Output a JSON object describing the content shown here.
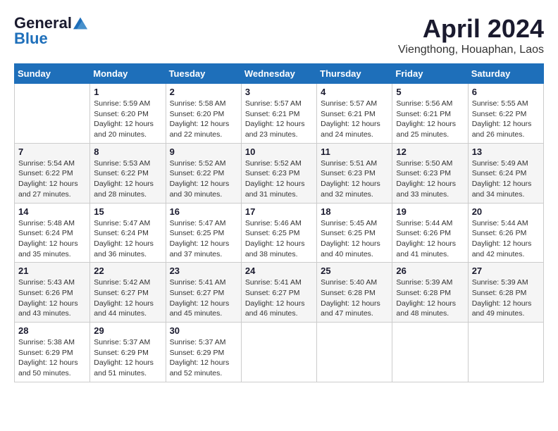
{
  "header": {
    "logo_general": "General",
    "logo_blue": "Blue",
    "month_title": "April 2024",
    "location": "Viengthong, Houaphan, Laos"
  },
  "calendar": {
    "days_of_week": [
      "Sunday",
      "Monday",
      "Tuesday",
      "Wednesday",
      "Thursday",
      "Friday",
      "Saturday"
    ],
    "weeks": [
      [
        {
          "day": "",
          "info": ""
        },
        {
          "day": "1",
          "info": "Sunrise: 5:59 AM\nSunset: 6:20 PM\nDaylight: 12 hours\nand 20 minutes."
        },
        {
          "day": "2",
          "info": "Sunrise: 5:58 AM\nSunset: 6:20 PM\nDaylight: 12 hours\nand 22 minutes."
        },
        {
          "day": "3",
          "info": "Sunrise: 5:57 AM\nSunset: 6:21 PM\nDaylight: 12 hours\nand 23 minutes."
        },
        {
          "day": "4",
          "info": "Sunrise: 5:57 AM\nSunset: 6:21 PM\nDaylight: 12 hours\nand 24 minutes."
        },
        {
          "day": "5",
          "info": "Sunrise: 5:56 AM\nSunset: 6:21 PM\nDaylight: 12 hours\nand 25 minutes."
        },
        {
          "day": "6",
          "info": "Sunrise: 5:55 AM\nSunset: 6:22 PM\nDaylight: 12 hours\nand 26 minutes."
        }
      ],
      [
        {
          "day": "7",
          "info": "Sunrise: 5:54 AM\nSunset: 6:22 PM\nDaylight: 12 hours\nand 27 minutes."
        },
        {
          "day": "8",
          "info": "Sunrise: 5:53 AM\nSunset: 6:22 PM\nDaylight: 12 hours\nand 28 minutes."
        },
        {
          "day": "9",
          "info": "Sunrise: 5:52 AM\nSunset: 6:22 PM\nDaylight: 12 hours\nand 30 minutes."
        },
        {
          "day": "10",
          "info": "Sunrise: 5:52 AM\nSunset: 6:23 PM\nDaylight: 12 hours\nand 31 minutes."
        },
        {
          "day": "11",
          "info": "Sunrise: 5:51 AM\nSunset: 6:23 PM\nDaylight: 12 hours\nand 32 minutes."
        },
        {
          "day": "12",
          "info": "Sunrise: 5:50 AM\nSunset: 6:23 PM\nDaylight: 12 hours\nand 33 minutes."
        },
        {
          "day": "13",
          "info": "Sunrise: 5:49 AM\nSunset: 6:24 PM\nDaylight: 12 hours\nand 34 minutes."
        }
      ],
      [
        {
          "day": "14",
          "info": "Sunrise: 5:48 AM\nSunset: 6:24 PM\nDaylight: 12 hours\nand 35 minutes."
        },
        {
          "day": "15",
          "info": "Sunrise: 5:47 AM\nSunset: 6:24 PM\nDaylight: 12 hours\nand 36 minutes."
        },
        {
          "day": "16",
          "info": "Sunrise: 5:47 AM\nSunset: 6:25 PM\nDaylight: 12 hours\nand 37 minutes."
        },
        {
          "day": "17",
          "info": "Sunrise: 5:46 AM\nSunset: 6:25 PM\nDaylight: 12 hours\nand 38 minutes."
        },
        {
          "day": "18",
          "info": "Sunrise: 5:45 AM\nSunset: 6:25 PM\nDaylight: 12 hours\nand 40 minutes."
        },
        {
          "day": "19",
          "info": "Sunrise: 5:44 AM\nSunset: 6:26 PM\nDaylight: 12 hours\nand 41 minutes."
        },
        {
          "day": "20",
          "info": "Sunrise: 5:44 AM\nSunset: 6:26 PM\nDaylight: 12 hours\nand 42 minutes."
        }
      ],
      [
        {
          "day": "21",
          "info": "Sunrise: 5:43 AM\nSunset: 6:26 PM\nDaylight: 12 hours\nand 43 minutes."
        },
        {
          "day": "22",
          "info": "Sunrise: 5:42 AM\nSunset: 6:27 PM\nDaylight: 12 hours\nand 44 minutes."
        },
        {
          "day": "23",
          "info": "Sunrise: 5:41 AM\nSunset: 6:27 PM\nDaylight: 12 hours\nand 45 minutes."
        },
        {
          "day": "24",
          "info": "Sunrise: 5:41 AM\nSunset: 6:27 PM\nDaylight: 12 hours\nand 46 minutes."
        },
        {
          "day": "25",
          "info": "Sunrise: 5:40 AM\nSunset: 6:28 PM\nDaylight: 12 hours\nand 47 minutes."
        },
        {
          "day": "26",
          "info": "Sunrise: 5:39 AM\nSunset: 6:28 PM\nDaylight: 12 hours\nand 48 minutes."
        },
        {
          "day": "27",
          "info": "Sunrise: 5:39 AM\nSunset: 6:28 PM\nDaylight: 12 hours\nand 49 minutes."
        }
      ],
      [
        {
          "day": "28",
          "info": "Sunrise: 5:38 AM\nSunset: 6:29 PM\nDaylight: 12 hours\nand 50 minutes."
        },
        {
          "day": "29",
          "info": "Sunrise: 5:37 AM\nSunset: 6:29 PM\nDaylight: 12 hours\nand 51 minutes."
        },
        {
          "day": "30",
          "info": "Sunrise: 5:37 AM\nSunset: 6:29 PM\nDaylight: 12 hours\nand 52 minutes."
        },
        {
          "day": "",
          "info": ""
        },
        {
          "day": "",
          "info": ""
        },
        {
          "day": "",
          "info": ""
        },
        {
          "day": "",
          "info": ""
        }
      ]
    ]
  }
}
